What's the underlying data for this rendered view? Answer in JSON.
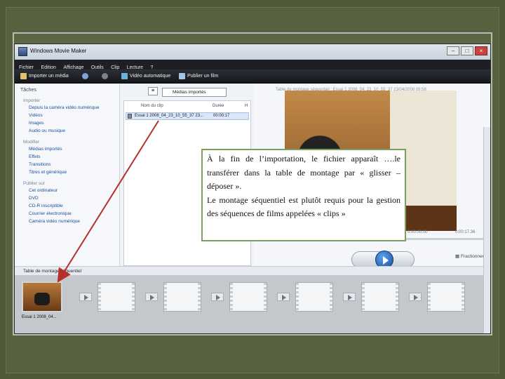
{
  "window": {
    "title": "Windows Movie Maker",
    "btn_min": "–",
    "btn_max": "□",
    "btn_close": "×"
  },
  "menu": [
    "Fichier",
    "Edition",
    "Affichage",
    "Outils",
    "Clip",
    "Lecture",
    "?"
  ],
  "toolbar": {
    "import": "Importer un média",
    "automovie": "Vidéo automatique",
    "publish": "Publier un film"
  },
  "tasks": {
    "title": "Tâches",
    "sections": [
      {
        "name": "Importer",
        "links": [
          "Depuis la caméra vidéo numérique",
          "Vidéos",
          "Images",
          "Audio ou musique"
        ]
      },
      {
        "name": "Modifier",
        "links": [
          "Médias importés",
          "Effets",
          "Transitions",
          "Titres et générique"
        ]
      },
      {
        "name": "Publier sur",
        "links": [
          "Cet ordinateur",
          "DVD",
          "CD-R inscriptible",
          "Courrier électronique",
          "Caméra vidéo numérique"
        ]
      }
    ]
  },
  "collections": {
    "dropdown": "Médias importés",
    "col_name": "Nom du clip",
    "col_duration": "Durée",
    "col_h": "H",
    "row": {
      "name": "Essai 1 2008_04_23_10_55_37 23...",
      "duration": "00:00:17"
    }
  },
  "preview": {
    "title": "Table de montage séquentiel : Essai 1 2008_04_23_10_55_37 23/04/2008 09:58",
    "time_current": "0:00:00.00",
    "time_total": "0:00:17.36",
    "split": "Fractionner"
  },
  "timeline": {
    "label": "Table de montage séquentiel",
    "clip_label": "Essai 1 2008_04..."
  },
  "callout": {
    "line1": "À la fin de l’importation, le fichier apparaît ….le transférer dans la table de montage par « glisser – déposer ».",
    "line2": "Le montage séquentiel est plutôt requis pour la gestion des séquences de films appelées « clips »"
  },
  "colors": {
    "arrow": "#b3312a",
    "callout_border": "#7aa05e"
  }
}
